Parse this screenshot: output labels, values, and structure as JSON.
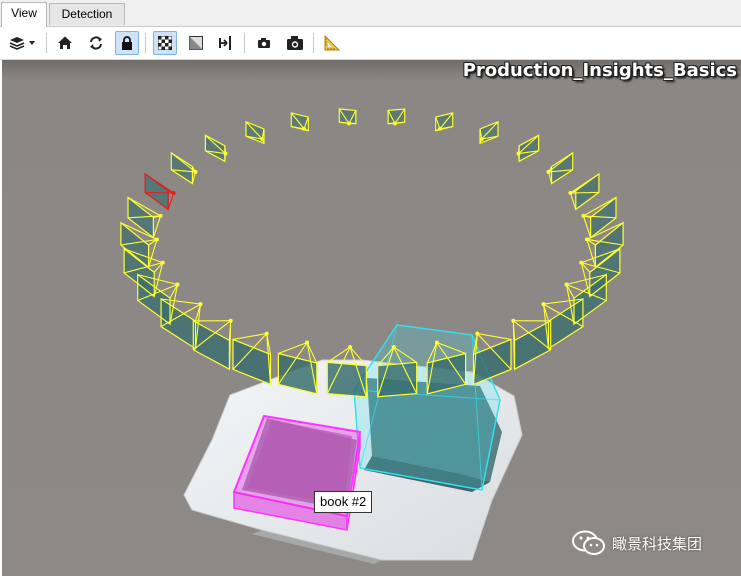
{
  "tabs": [
    {
      "label": "View",
      "active": true
    },
    {
      "label": "Detection",
      "active": false
    }
  ],
  "toolbar": {
    "buttons": [
      {
        "name": "layers-menu-button",
        "icon": "layers-icon",
        "pressed": false
      },
      {
        "name": "home-view-button",
        "icon": "home-icon",
        "pressed": false
      },
      {
        "name": "reset-rotation-button",
        "icon": "rotate-icon",
        "pressed": false
      },
      {
        "name": "lock-button",
        "icon": "lock-icon",
        "pressed": true
      },
      {
        "name": "checkerboard-button",
        "icon": "checkerboard-icon",
        "pressed": true
      },
      {
        "name": "shading-button",
        "icon": "shading-icon",
        "pressed": false
      },
      {
        "name": "fit-view-button",
        "icon": "fit-icon",
        "pressed": false
      },
      {
        "name": "snapshot-small-button",
        "icon": "camera-small-icon",
        "pressed": false
      },
      {
        "name": "snapshot-button",
        "icon": "camera-icon",
        "pressed": false
      },
      {
        "name": "measure-button",
        "icon": "ruler-icon",
        "pressed": false
      }
    ]
  },
  "viewport": {
    "title": "Production_Insights_Basics",
    "object_label": "book #2",
    "watermark": "瞰景科技集团",
    "colors": {
      "background": "#8b8784",
      "camera_frustum": "#ffff33",
      "selected_camera": "#e02020",
      "camera_image": "#3a6e6e",
      "bbox_book_1": "#33e0f0",
      "bbox_book_2": "#e020e0",
      "ground": "#eef0f2"
    }
  }
}
